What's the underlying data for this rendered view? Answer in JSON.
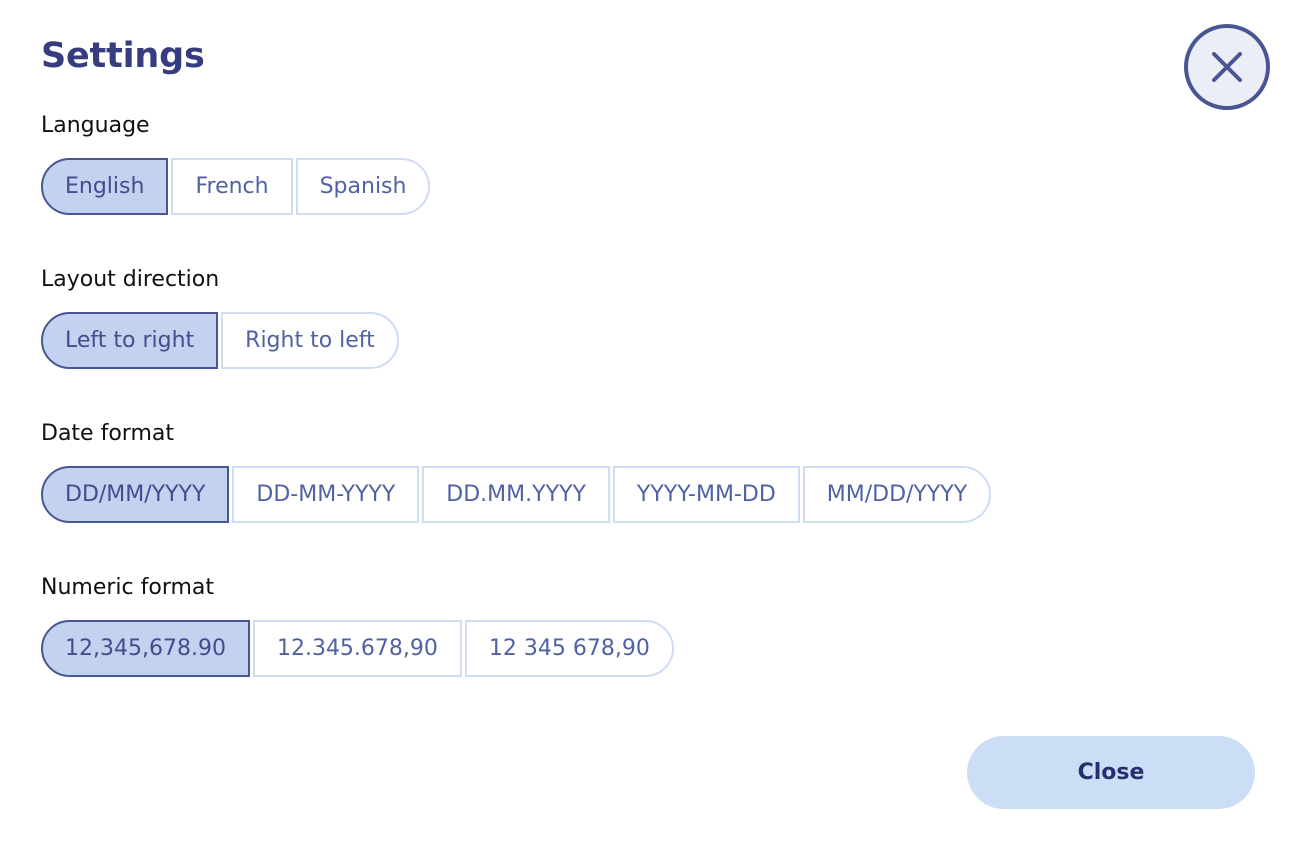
{
  "dialog": {
    "title": "Settings",
    "close_icon": "close-icon"
  },
  "sections": [
    {
      "label": "Language",
      "options": [
        "English",
        "French",
        "Spanish"
      ],
      "selected_index": 0
    },
    {
      "label": "Layout direction",
      "options": [
        "Left to right",
        "Right to left"
      ],
      "selected_index": 0
    },
    {
      "label": "Date format",
      "options": [
        "DD/MM/YYYY",
        "DD-MM-YYYY",
        "DD.MM.YYYY",
        "YYYY-MM-DD",
        "MM/DD/YYYY"
      ],
      "selected_index": 0
    },
    {
      "label": "Numeric format",
      "options": [
        "12,345,678.90",
        "12.345.678,90",
        "12 345 678,90"
      ],
      "selected_index": 0
    }
  ],
  "footer": {
    "close_label": "Close"
  },
  "colors": {
    "title": "#363c7f",
    "selected_fill": "#c3d2ee",
    "selected_border": "#4a5694",
    "unselected_border": "#cfdcf3",
    "segment_text": "#5061a4",
    "close_button_fill": "#ccdef5",
    "close_button_text": "#27306e",
    "close_icon_fill": "#eceef7",
    "background": "#ffffff"
  },
  "layout": {
    "section_tops": [
      112,
      266,
      420,
      574
    ]
  }
}
